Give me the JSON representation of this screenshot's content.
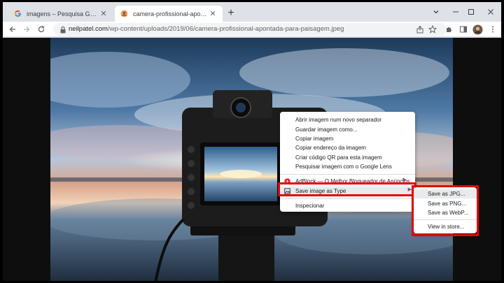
{
  "tabs": [
    {
      "label": "imagens – Pesquisa Google",
      "active": false,
      "favicon": "google-icon"
    },
    {
      "label": "camera-profissional-apontada-p",
      "active": true,
      "favicon": "site-icon"
    }
  ],
  "toolbar": {
    "url_host": "neilpatel.com",
    "url_path": "/wp-content/uploads/2019/06/camera-profissional-apontada-para-paisagem.jpeg"
  },
  "context_menu": {
    "items": [
      {
        "label": "Abrir imagem num novo separador"
      },
      {
        "label": "Guardar imagem como..."
      },
      {
        "label": "Copiar imagem"
      },
      {
        "label": "Copiar endereço da imagem"
      },
      {
        "label": "Criar código QR para esta imagem"
      },
      {
        "label": "Pesquisar imagem com o Google Lens"
      },
      {
        "label": "AdBlock — O Melhor Bloqueador de Anúncios"
      },
      {
        "label": "Save image as Type"
      },
      {
        "label": "Inspecionar"
      }
    ]
  },
  "submenu": {
    "items": [
      {
        "label": "Save as JPG..."
      },
      {
        "label": "Save as PNG..."
      },
      {
        "label": "Save as WebP..."
      },
      {
        "label": "View in store..."
      }
    ]
  },
  "colors": {
    "highlight": "#e10600",
    "tab_bar": "#dee1e6",
    "adblock_red": "#e3242b"
  }
}
